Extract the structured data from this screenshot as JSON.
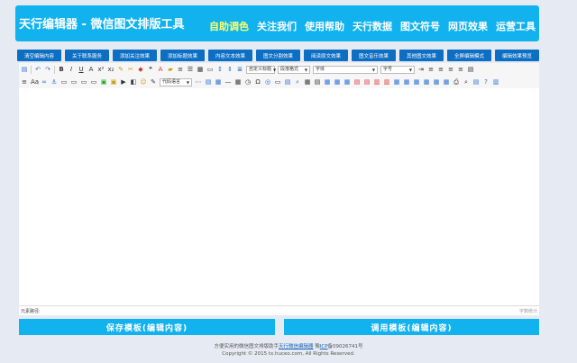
{
  "header": {
    "logo": "天行编辑器 - 微信图文排版工具",
    "nav": [
      "自助调色",
      "关注我们",
      "使用帮助",
      "天行数据",
      "图文符号",
      "网页效果",
      "运营工具"
    ]
  },
  "quick_buttons": [
    "清空编辑内容",
    "关于联系服务",
    "添加关注效果",
    "添加标题效果",
    "内容文本效果",
    "图文分割效果",
    "阅读原文效果",
    "图文音乐效果",
    "其他图文效果",
    "全屏编辑模式",
    "编辑效果预览"
  ],
  "toolbar": {
    "paragraph_select": "自定义标题",
    "heading_select": "段落格式",
    "font_family_select": "字体",
    "font_size_select": "字号",
    "code_lang_select": "代码语言"
  },
  "status": {
    "path_label": "元素路径:",
    "word_count_label": "字数统计"
  },
  "actions": {
    "save_template": "保存模板(编辑内容)",
    "use_template": "调用模板(编辑内容)"
  },
  "footer": {
    "line1_prefix": "方便实用的微信图文排版助手",
    "line1_link": "天行微信编辑器",
    "line1_mid": " 豫",
    "line1_icp": "ICP",
    "line1_suffix": "备09026741号",
    "copyright": "Copyright © 2015 tx.huceo.com, All Rights Reserved."
  },
  "colors": {
    "brand": "#12b2ee",
    "button_dark": "#0d6fc4",
    "active_nav": "#ffff66"
  }
}
